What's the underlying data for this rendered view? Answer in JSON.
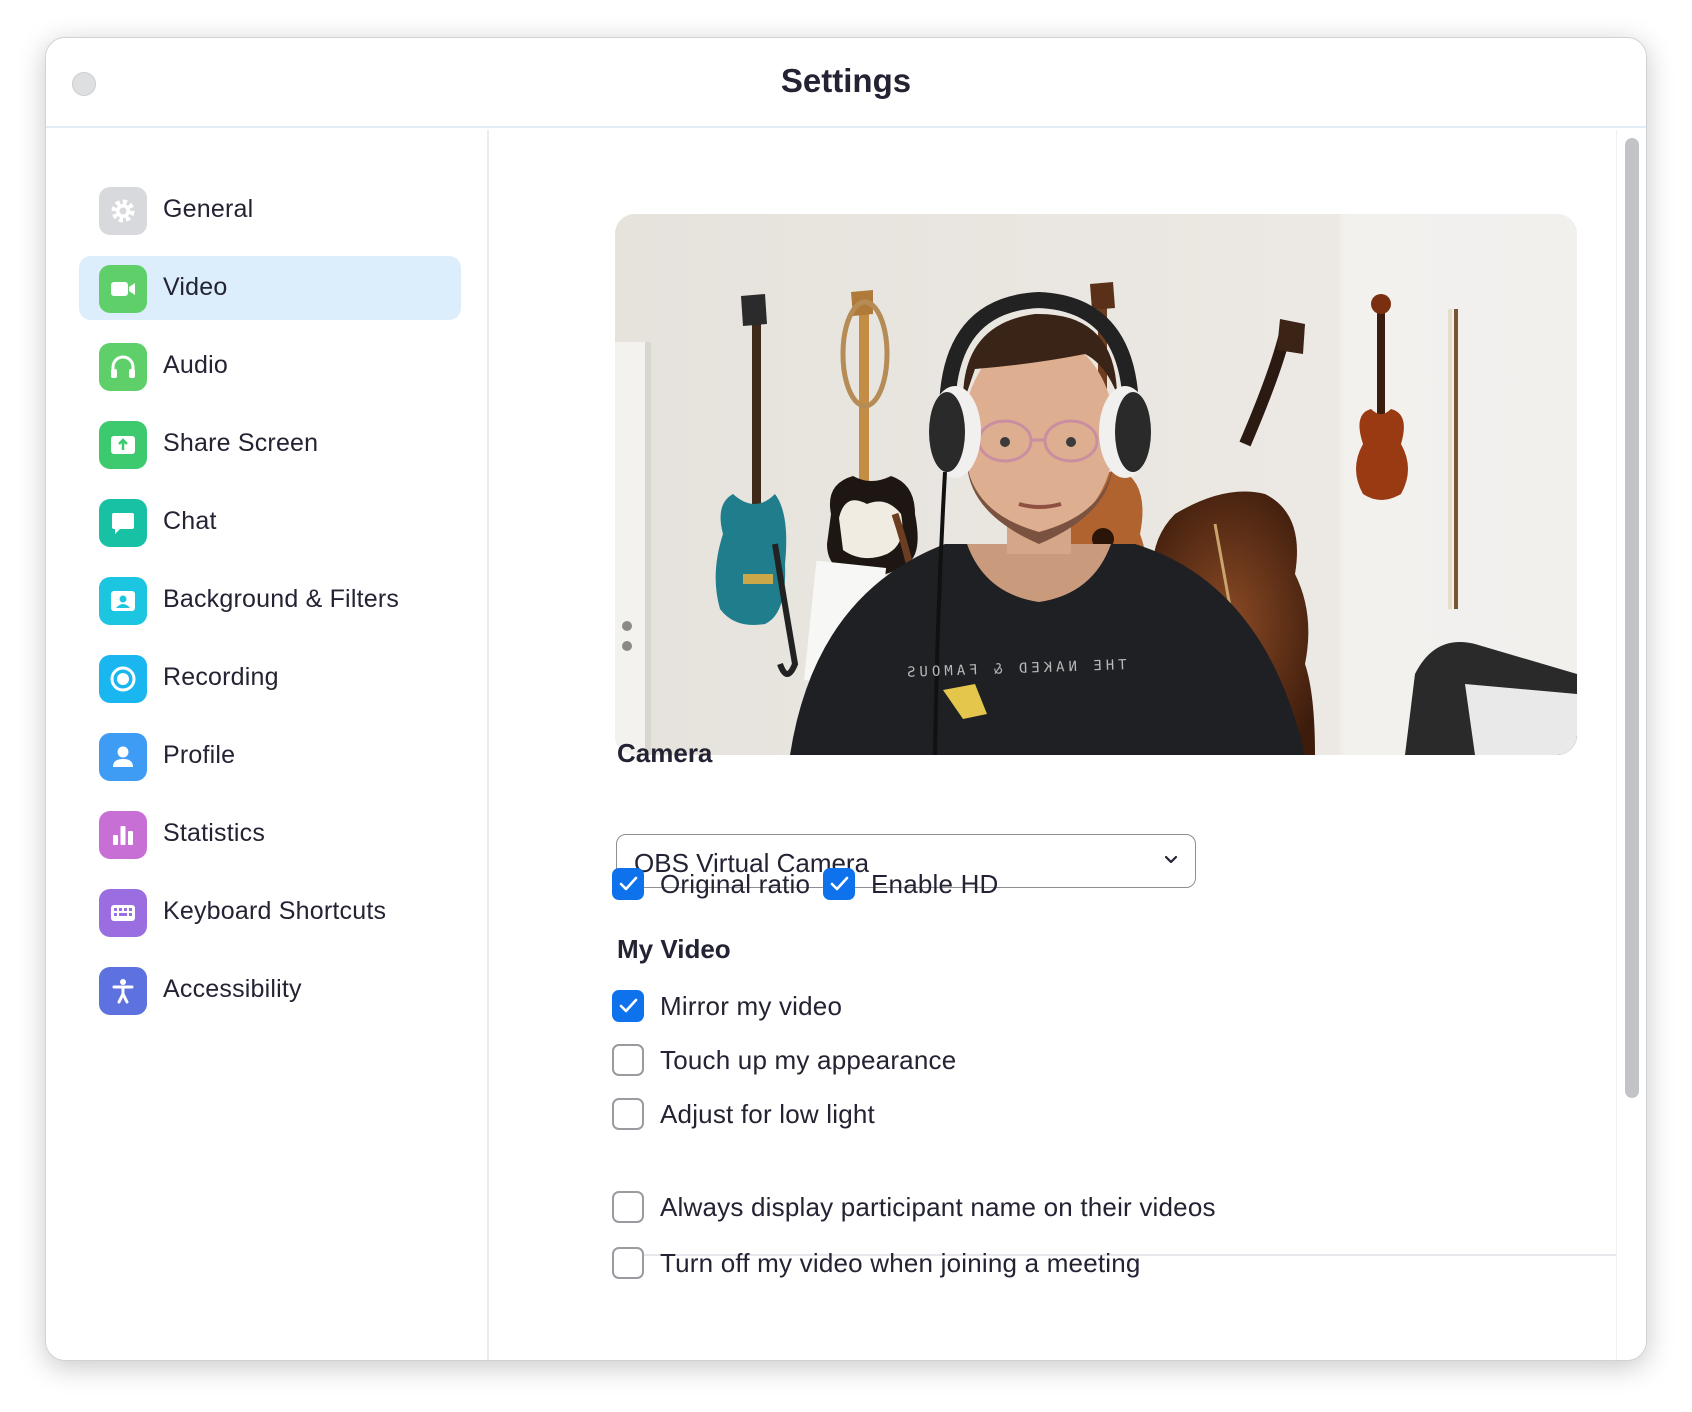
{
  "window": {
    "title": "Settings"
  },
  "sidebar": {
    "items": [
      {
        "label": "General",
        "icon": "gear-icon",
        "color": "#d8d9dc",
        "active": false
      },
      {
        "label": "Video",
        "icon": "video-camera-icon",
        "color": "#5fcf6a",
        "active": true
      },
      {
        "label": "Audio",
        "icon": "headphones-icon",
        "color": "#5fcf6a",
        "active": false
      },
      {
        "label": "Share Screen",
        "icon": "share-screen-icon",
        "color": "#3dc96e",
        "active": false
      },
      {
        "label": "Chat",
        "icon": "chat-bubble-icon",
        "color": "#18c1a4",
        "active": false
      },
      {
        "label": "Background & Filters",
        "icon": "background-person-icon",
        "color": "#1dc6e0",
        "active": false
      },
      {
        "label": "Recording",
        "icon": "record-icon",
        "color": "#1ab6f0",
        "active": false
      },
      {
        "label": "Profile",
        "icon": "profile-person-icon",
        "color": "#3f9cf5",
        "active": false
      },
      {
        "label": "Statistics",
        "icon": "bar-chart-icon",
        "color": "#c86fd6",
        "active": false
      },
      {
        "label": "Keyboard Shortcuts",
        "icon": "keyboard-icon",
        "color": "#9a6ee0",
        "active": false
      },
      {
        "label": "Accessibility",
        "icon": "accessibility-icon",
        "color": "#5d71df",
        "active": false
      }
    ]
  },
  "video": {
    "camera_title": "Camera",
    "camera_select": "OBS Virtual Camera",
    "original_ratio": {
      "label": "Original ratio",
      "checked": true
    },
    "enable_hd": {
      "label": "Enable HD",
      "checked": true
    },
    "my_video_title": "My Video",
    "mirror": {
      "label": "Mirror my video",
      "checked": true
    },
    "touch_up": {
      "label": "Touch up my appearance",
      "checked": false
    },
    "low_light": {
      "label": "Adjust for low light",
      "checked": false
    },
    "display_names": {
      "label": "Always display participant name on their videos",
      "checked": false
    },
    "turn_off_video": {
      "label": "Turn off my video when joining a meeting",
      "checked": false
    },
    "shirt_text": "THE NAKED & FAMOUS"
  },
  "colors": {
    "accent": "#0e72ed",
    "active_nav_bg": "#dcedfc"
  }
}
